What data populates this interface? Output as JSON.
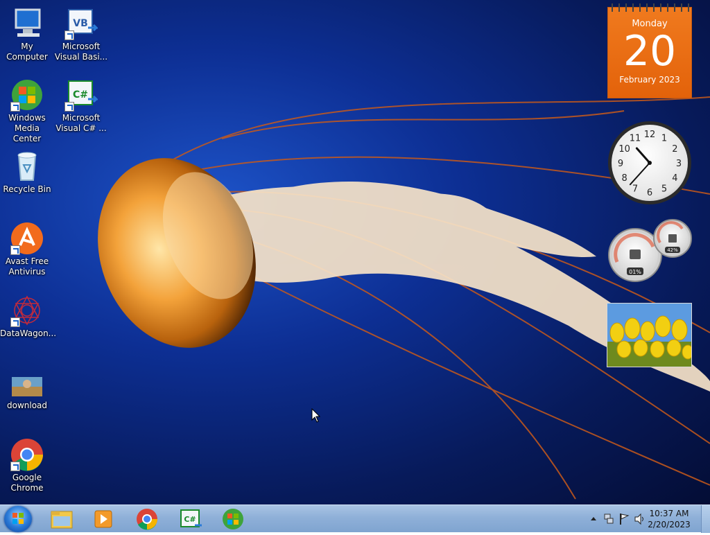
{
  "desktop_icons": [
    {
      "label_1": "My Computer",
      "label_2": ""
    },
    {
      "label_1": "Microsoft",
      "label_2": "Visual Basi..."
    },
    {
      "label_1": "Windows",
      "label_2": "Media Center"
    },
    {
      "label_1": "Microsoft",
      "label_2": "Visual C# ..."
    },
    {
      "label_1": "Recycle Bin",
      "label_2": ""
    },
    {
      "label_1": "Avast Free",
      "label_2": "Antivirus"
    },
    {
      "label_1": "DataWagon...",
      "label_2": ""
    },
    {
      "label_1": "download",
      "label_2": ""
    },
    {
      "label_1": "Google",
      "label_2": "Chrome"
    }
  ],
  "calendar_gadget": {
    "weekday": "Monday",
    "day": "20",
    "month_year": "February 2023"
  },
  "clock_gadget": {
    "hour": 10,
    "minute": 37
  },
  "cpu_meter_gadget": {
    "cpu_percent": "01%",
    "memory_percent": "42%"
  },
  "vb_badge": "VB",
  "cs_badge": "C#",
  "taskbar": {
    "pinned": [
      "windows-explorer",
      "windows-media-player",
      "google-chrome",
      "visual-csharp",
      "windows-media-center"
    ]
  },
  "tray": {
    "time": "10:37 AM",
    "date": "2/20/2023"
  },
  "colors": {
    "calendar": "#ea6c12",
    "taskbar": "#8fb0d8"
  }
}
